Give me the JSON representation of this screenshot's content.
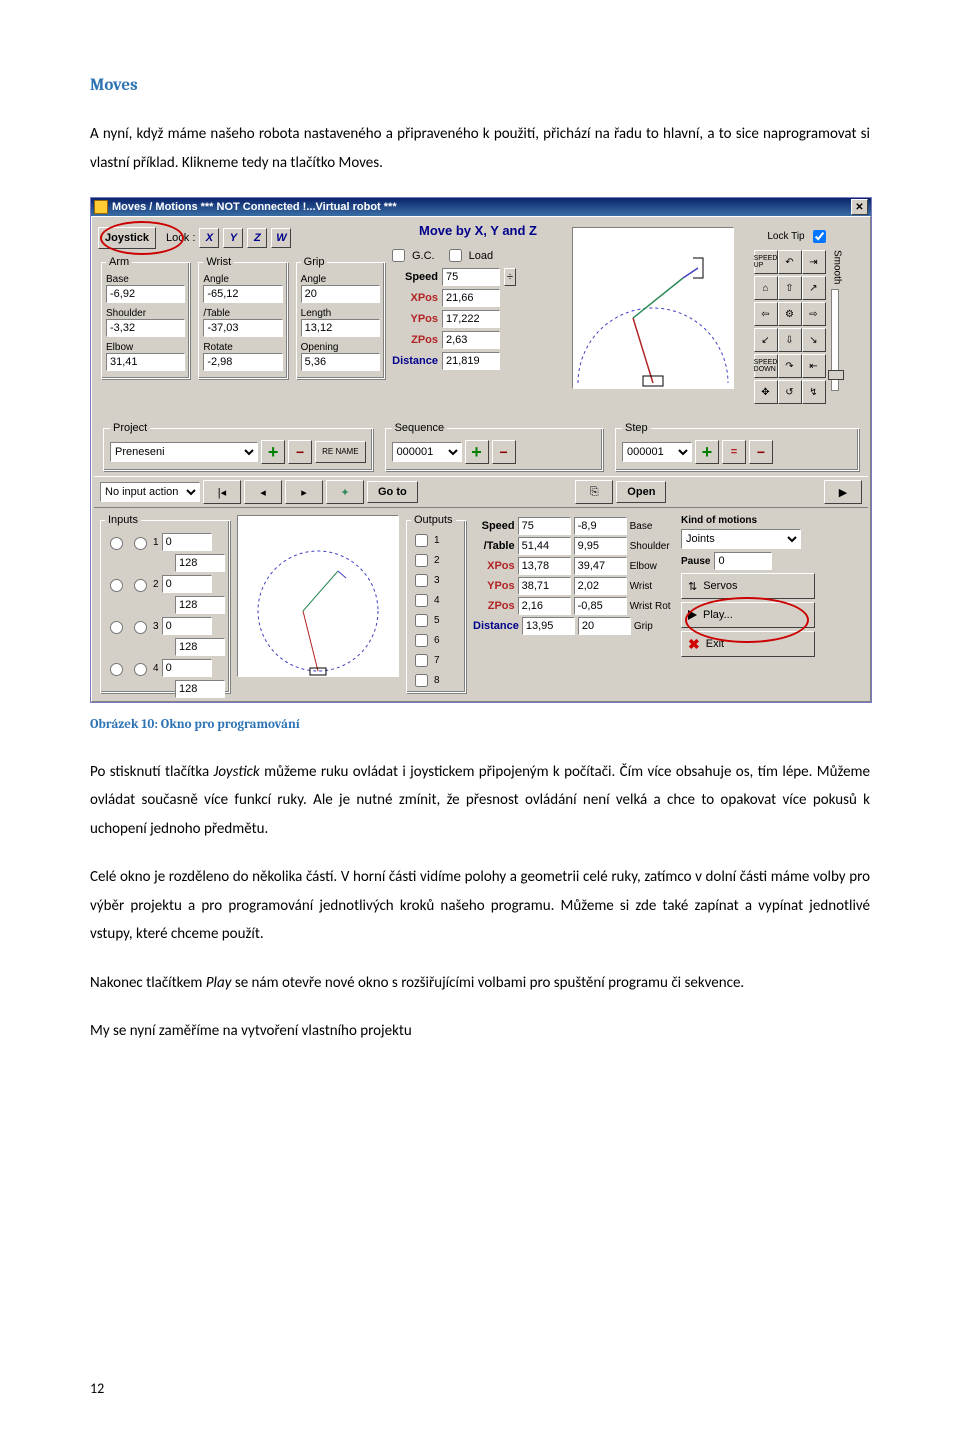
{
  "section_title": "Moves",
  "para1": "A nyní, když máme našeho robota nastaveného a připraveného k použití, přichází na řadu to hlavní, a to sice naprogramovat si vlastní příklad. Klikneme tedy na tlačítko Moves.",
  "caption": "Obrázek 10: Okno pro programování",
  "para2": "Po stisknutí tlačítka Joystick můžeme ruku ovládat i joystickem připojeným k počítači. Čím více obsahuje os, tím lépe. Můžeme ovládat současně více funkcí ruky. Ale je nutné zmínit, že přesnost ovládání není velká a chce to opakovat více pokusů k uchopení jednoho předmětu.",
  "para3": "Celé okno je rozděleno do několika částí. V horní části vidíme polohy a geometrii celé ruky, zatímco v dolní části máme volby pro výběr projektu a pro programování jednotlivých kroků našeho programu. Můžeme si zde také zapínat a vypínat jednotlivé vstupy, které chceme použít.",
  "para4": "Nakonec tlačítkem Play se nám otevře nové okno s rozšiřujícími volbami pro spuštění programu či sekvence.",
  "para5": "My se nyní zaměříme na vytvoření vlastního projektu",
  "page_number": "12",
  "win": {
    "title": "Moves / Motions   *** NOT Connected !...Virtual robot ***",
    "joystick": "Joystick",
    "lock_label": "Lock :",
    "x": "X",
    "y": "Y",
    "z": "Z",
    "w": "W",
    "move_by": "Move by X, Y and Z",
    "lock_tip": "Lock Tip",
    "smooth": "Smooth",
    "gc": "G.C.",
    "load": "Load",
    "speed": "Speed",
    "speed_val": "75",
    "xpos": "XPos",
    "xpos_val": "21,66",
    "ypos": "YPos",
    "ypos_val": "17,222",
    "zpos": "ZPos",
    "zpos_val": "2,63",
    "distance": "Distance",
    "distance_val": "21,819",
    "arm_legend": "Arm",
    "arm_base": "Base",
    "arm_base_v": "-6,92",
    "arm_shoulder": "Shoulder",
    "arm_shoulder_v": "-3,32",
    "arm_elbow": "Elbow",
    "arm_elbow_v": "31,41",
    "wrist_legend": "Wrist",
    "wrist_angle": "Angle",
    "wrist_angle_v": "-65,12",
    "wrist_table": "/Table",
    "wrist_table_v": "-37,03",
    "wrist_rotate": "Rotate",
    "wrist_rotate_v": "-2,98",
    "grip_legend": "Grip",
    "grip_angle": "Angle",
    "grip_angle_v": "20",
    "grip_length": "Length",
    "grip_length_v": "13,12",
    "grip_open": "Opening",
    "grip_open_v": "5,36",
    "project": "Project",
    "project_val": "Preneseni",
    "sequence": "Sequence",
    "sequence_val": "000001",
    "step": "Step",
    "step_val": "000001",
    "rename": "RE NAME",
    "no_input": "No input action",
    "goto": "Go to",
    "open": "Open",
    "inputs": "Inputs",
    "i_zero": "0",
    "i_128": "128",
    "outputs": "Outputs",
    "bspeed": "Speed",
    "bspeed_v": "75",
    "btable": "/Table",
    "btable_v": "51,44",
    "bxpos": "XPos",
    "bxpos_v": "13,78",
    "bypos": "YPos",
    "bypos_v": "38,71",
    "bzpos": "ZPos",
    "bzpos_v": "2,16",
    "bdist": "Distance",
    "bdist_v": "13,95",
    "col2_1": "-8,9",
    "col2_1_l": "Base",
    "col2_2": "9,95",
    "col2_2_l": "Shoulder",
    "col2_3": "39,47",
    "col2_3_l": "Elbow",
    "col2_4": "2,02",
    "col2_4_l": "Wrist",
    "col2_5": "-0,85",
    "col2_5_l": "Wrist Rot",
    "col2_6": "20",
    "col2_6_l": "Grip",
    "kom": "Kind of motions",
    "kom_val": "Joints",
    "pause": "Pause",
    "pause_v": "0",
    "servos": "Servos",
    "play": "Play...",
    "exit": "Exit"
  }
}
